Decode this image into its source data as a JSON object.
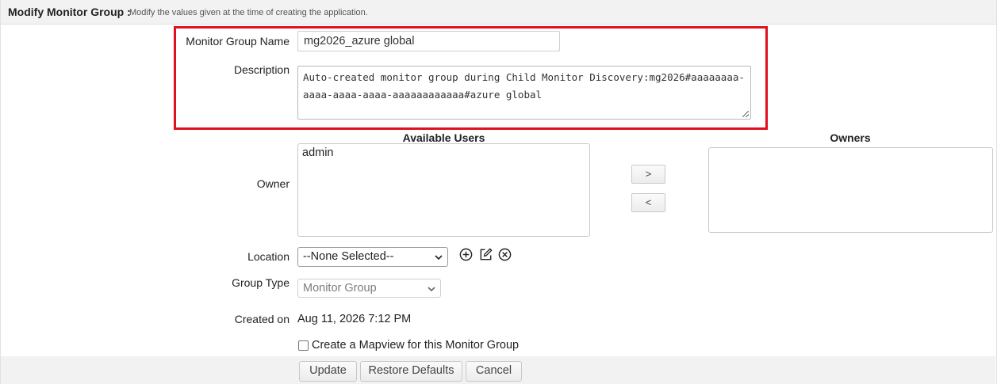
{
  "header": {
    "title": "Modify Monitor Group :",
    "subtitle": "Modify the values given at the time of creating the application."
  },
  "form": {
    "group_name": {
      "label": "Monitor Group Name",
      "value": "mg2026_azure global"
    },
    "description": {
      "label": "Description",
      "value": "Auto-created monitor group during Child Monitor Discovery:mg2026#aaaaaaaa-aaaa-aaaa-aaaa-aaaaaaaaaaaa#azure global"
    },
    "owner": {
      "label": "Owner",
      "available_users_header": "Available Users",
      "owners_header": "Owners",
      "available_users": [
        "admin"
      ],
      "owners": [],
      "add_label": ">",
      "remove_label": "<"
    },
    "location": {
      "label": "Location",
      "selected": "--None Selected--",
      "icons": [
        "add-icon",
        "edit-icon",
        "delete-icon"
      ]
    },
    "group_type": {
      "label": "Group Type",
      "selected": "Monitor Group",
      "disabled": true
    },
    "created_on": {
      "label": "Created on",
      "value": "Aug 11, 2026 7:12 PM"
    },
    "mapview_checkbox": {
      "label": "Create a Mapview for this Monitor Group",
      "checked": false
    }
  },
  "buttons": {
    "update": "Update",
    "restore_defaults": "Restore Defaults",
    "cancel": "Cancel"
  },
  "colors": {
    "highlight_border": "#e0101e",
    "header_bg": "#f2f2f2"
  }
}
